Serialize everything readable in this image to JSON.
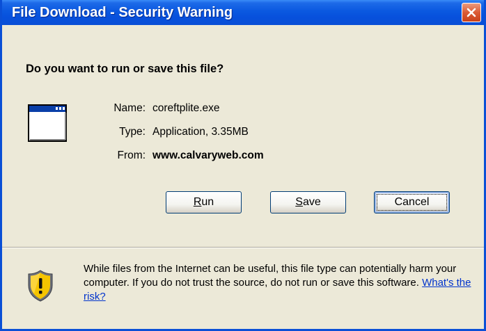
{
  "window": {
    "title": "File Download - Security Warning"
  },
  "dialog": {
    "question": "Do you want to run or save this file?",
    "name_label": "Name:",
    "name_value": "coreftplite.exe",
    "type_label": "Type:",
    "type_value": "Application, 3.35MB",
    "from_label": "From:",
    "from_value": "www.calvaryweb.com"
  },
  "buttons": {
    "run_mnemonic": "R",
    "run_rest": "un",
    "save_mnemonic": "S",
    "save_rest": "ave",
    "cancel": "Cancel"
  },
  "warning": {
    "text": "While files from the Internet can be useful, this file type can potentially harm your computer. If you do not trust the source, do not run or save this software. ",
    "link": "What's the risk?"
  },
  "colors": {
    "titlebar": "#0a58e0",
    "close_button": "#db5b35",
    "link": "#0033cc",
    "shield_yellow": "#f5c400"
  },
  "icons": [
    "close-icon",
    "application-icon",
    "security-shield-icon"
  ]
}
